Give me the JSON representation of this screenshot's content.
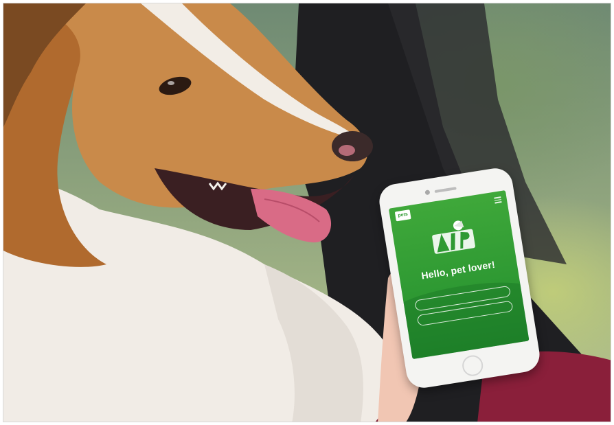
{
  "photo": {
    "subject": "dog-and-phone-photo"
  },
  "phone": {
    "logo_text": "pets",
    "greeting": "Hello, pet lover!",
    "subline": "",
    "button_1": "",
    "button_2": "",
    "footer_link": "",
    "colors": {
      "screen_green": "#2f9a33",
      "phone_white": "#f4f4f2"
    },
    "icons": [
      "menu-icon",
      "vip-hero-illustration"
    ]
  }
}
